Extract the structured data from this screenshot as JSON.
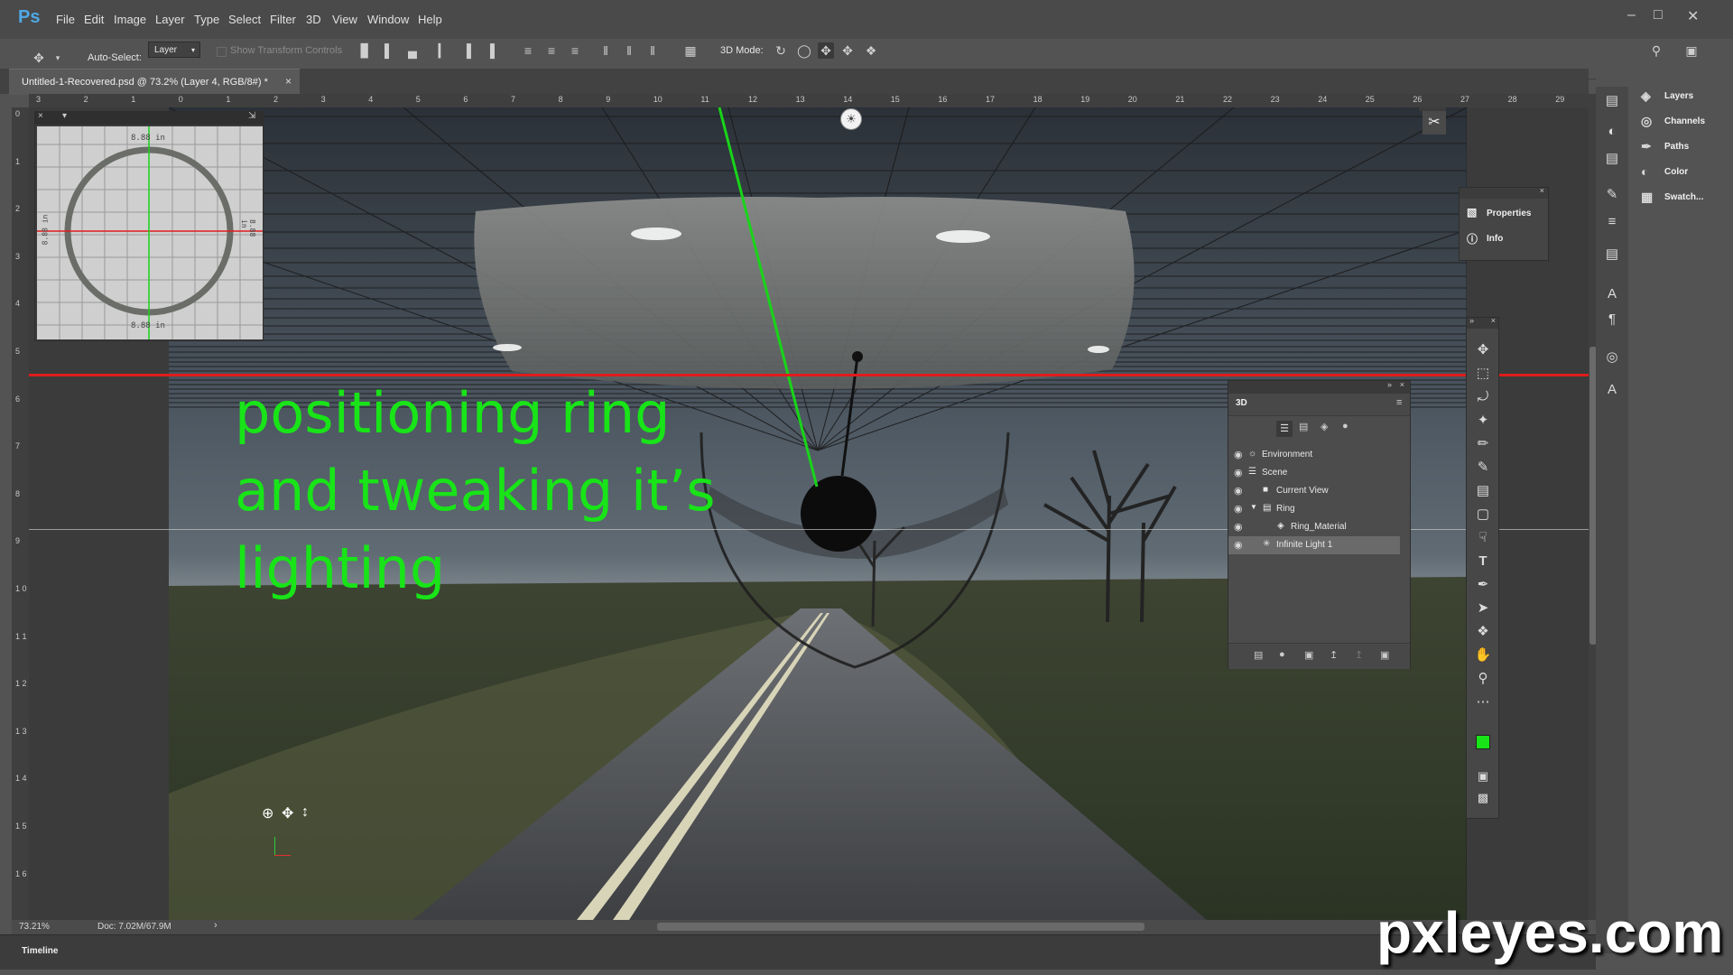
{
  "app": {
    "logo": "Ps",
    "menu": [
      "File",
      "Edit",
      "Image",
      "Layer",
      "Type",
      "Select",
      "Filter",
      "3D",
      "View",
      "Window",
      "Help"
    ],
    "window_controls": [
      "minimize-icon",
      "restore-icon",
      "close-icon"
    ]
  },
  "options_bar": {
    "auto_select_label": "Auto-Select:",
    "auto_select_checked": true,
    "auto_select_target": "Layer",
    "show_transform_label": "Show Transform Controls",
    "mode_label": "3D Mode:"
  },
  "document": {
    "tab_title": "Untitled-1-Recovered.psd @ 73.2% (Layer 4, RGB/8#) *",
    "tab_close": "×"
  },
  "rulers": {
    "top_ticks": [
      "3",
      "2",
      "1",
      "0",
      "1",
      "2",
      "3",
      "4",
      "5",
      "6",
      "7",
      "8",
      "9",
      "10",
      "11",
      "12",
      "13",
      "14",
      "15",
      "16",
      "17",
      "18",
      "19",
      "20",
      "21",
      "22",
      "23",
      "24",
      "25",
      "26",
      "27",
      "28",
      "29"
    ],
    "left_ticks": [
      "0",
      "1",
      "2",
      "3",
      "4",
      "5",
      "6",
      "7",
      "8",
      "9",
      "1 0",
      "1 1",
      "1 2",
      "1 3",
      "1 4",
      "1 5",
      "1 6"
    ]
  },
  "canvas": {
    "overlay_text": [
      "positioning ring",
      "and tweaking it’s",
      "lighting"
    ],
    "overlay_color": "#18e418",
    "ring_view": {
      "top_label": "8.88 in",
      "bottom_label": "8.88 in",
      "left_label": "8.88 in",
      "right_label": "8.88 in"
    }
  },
  "status": {
    "zoom": "73.21%",
    "doc_info": "Doc: 7.02M/67.9M"
  },
  "timeline": {
    "label": "Timeline"
  },
  "dock": {
    "items": [
      {
        "label": "Layers",
        "icon": "layers-icon"
      },
      {
        "label": "Channels",
        "icon": "channels-icon"
      },
      {
        "label": "Paths",
        "icon": "paths-icon"
      },
      {
        "label": "Color",
        "icon": "color-icon"
      },
      {
        "label": "Swatch...",
        "icon": "swatches-icon"
      }
    ]
  },
  "properties_panel": {
    "items": [
      {
        "label": "Properties",
        "icon": "properties-icon"
      },
      {
        "label": "Info",
        "icon": "info-icon"
      }
    ]
  },
  "panel_3d": {
    "title": "3D",
    "rows": [
      {
        "label": "Environment",
        "indent": 0,
        "selected": false
      },
      {
        "label": "Scene",
        "indent": 0,
        "selected": false
      },
      {
        "label": "Current View",
        "indent": 1,
        "selected": false
      },
      {
        "label": "Ring",
        "indent": 1,
        "selected": false
      },
      {
        "label": "Ring_Material",
        "indent": 2,
        "selected": false
      },
      {
        "label": "Infinite Light 1",
        "indent": 1,
        "selected": true
      }
    ]
  },
  "colors": {
    "foreground": "#18e418",
    "background": "#ffffff",
    "guide_red": "#e01c1c",
    "guide_green": "#19d419"
  },
  "watermark": "pxleyes.com"
}
